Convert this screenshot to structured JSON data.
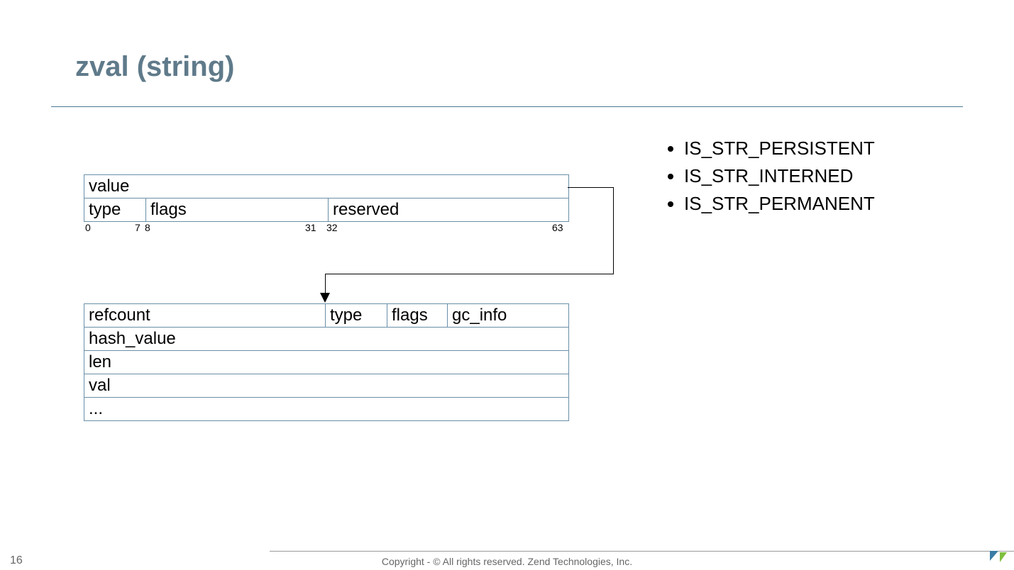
{
  "title": "zval (string)",
  "zval": {
    "row1": {
      "value": "value"
    },
    "row2": {
      "type": "type",
      "flags": "flags",
      "reserved": "reserved"
    }
  },
  "bit_labels": {
    "b0": "0",
    "b7": "7",
    "b8": "8",
    "b31": "31",
    "b32": "32",
    "b63": "63"
  },
  "str": {
    "row1": {
      "refcount": "refcount",
      "type": "type",
      "flags": "flags",
      "gc_info": "gc_info"
    },
    "row2": "hash_value",
    "row3": "len",
    "row4": "val",
    "row5": "..."
  },
  "bullets": [
    "IS_STR_PERSISTENT",
    "IS_STR_INTERNED",
    "IS_STR_PERMANENT"
  ],
  "footer": {
    "copyright": "Copyright - © All rights reserved. Zend Technologies, Inc.",
    "page": "16"
  }
}
